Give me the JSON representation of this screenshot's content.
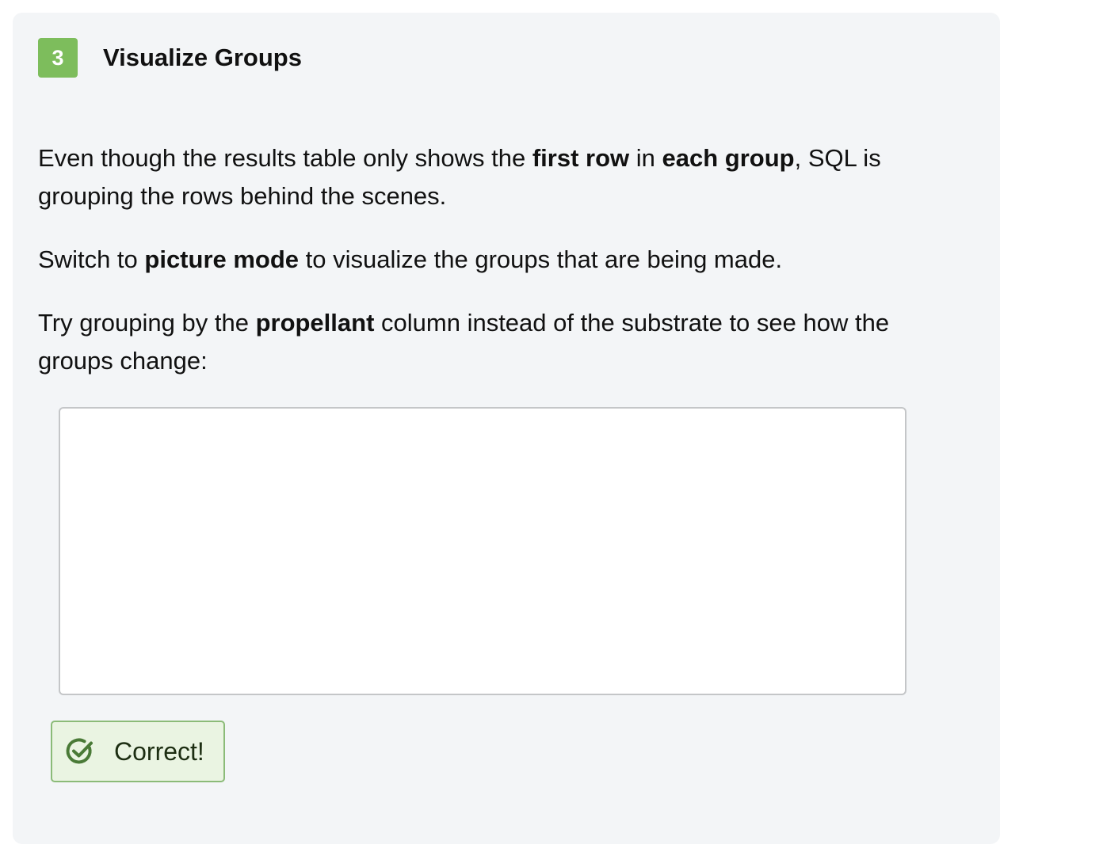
{
  "step": {
    "number": "3",
    "title": "Visualize Groups"
  },
  "instructions": {
    "p1": {
      "t1": "Even though the results table only shows the ",
      "b1": "first row",
      "t2": " in ",
      "b2": "each group",
      "t3": ", SQL is grouping the rows behind the scenes."
    },
    "p2": {
      "t1": "Switch to ",
      "b1": "picture mode",
      "t2": " to visualize the groups that are being made."
    },
    "p3": {
      "t1": "Try grouping by the ",
      "b1": "propellant",
      "t2": " column instead of the substrate to see how the groups change:"
    }
  },
  "editor": {
    "content": ""
  },
  "feedback": {
    "label": "Correct!",
    "icon": "check-circle-icon"
  },
  "colors": {
    "badge": "#7dbd5c",
    "card_background": "#f3f5f7",
    "success_background": "#eaf4e2",
    "success_border": "#8bbb78",
    "success_icon": "#4a7a37"
  }
}
